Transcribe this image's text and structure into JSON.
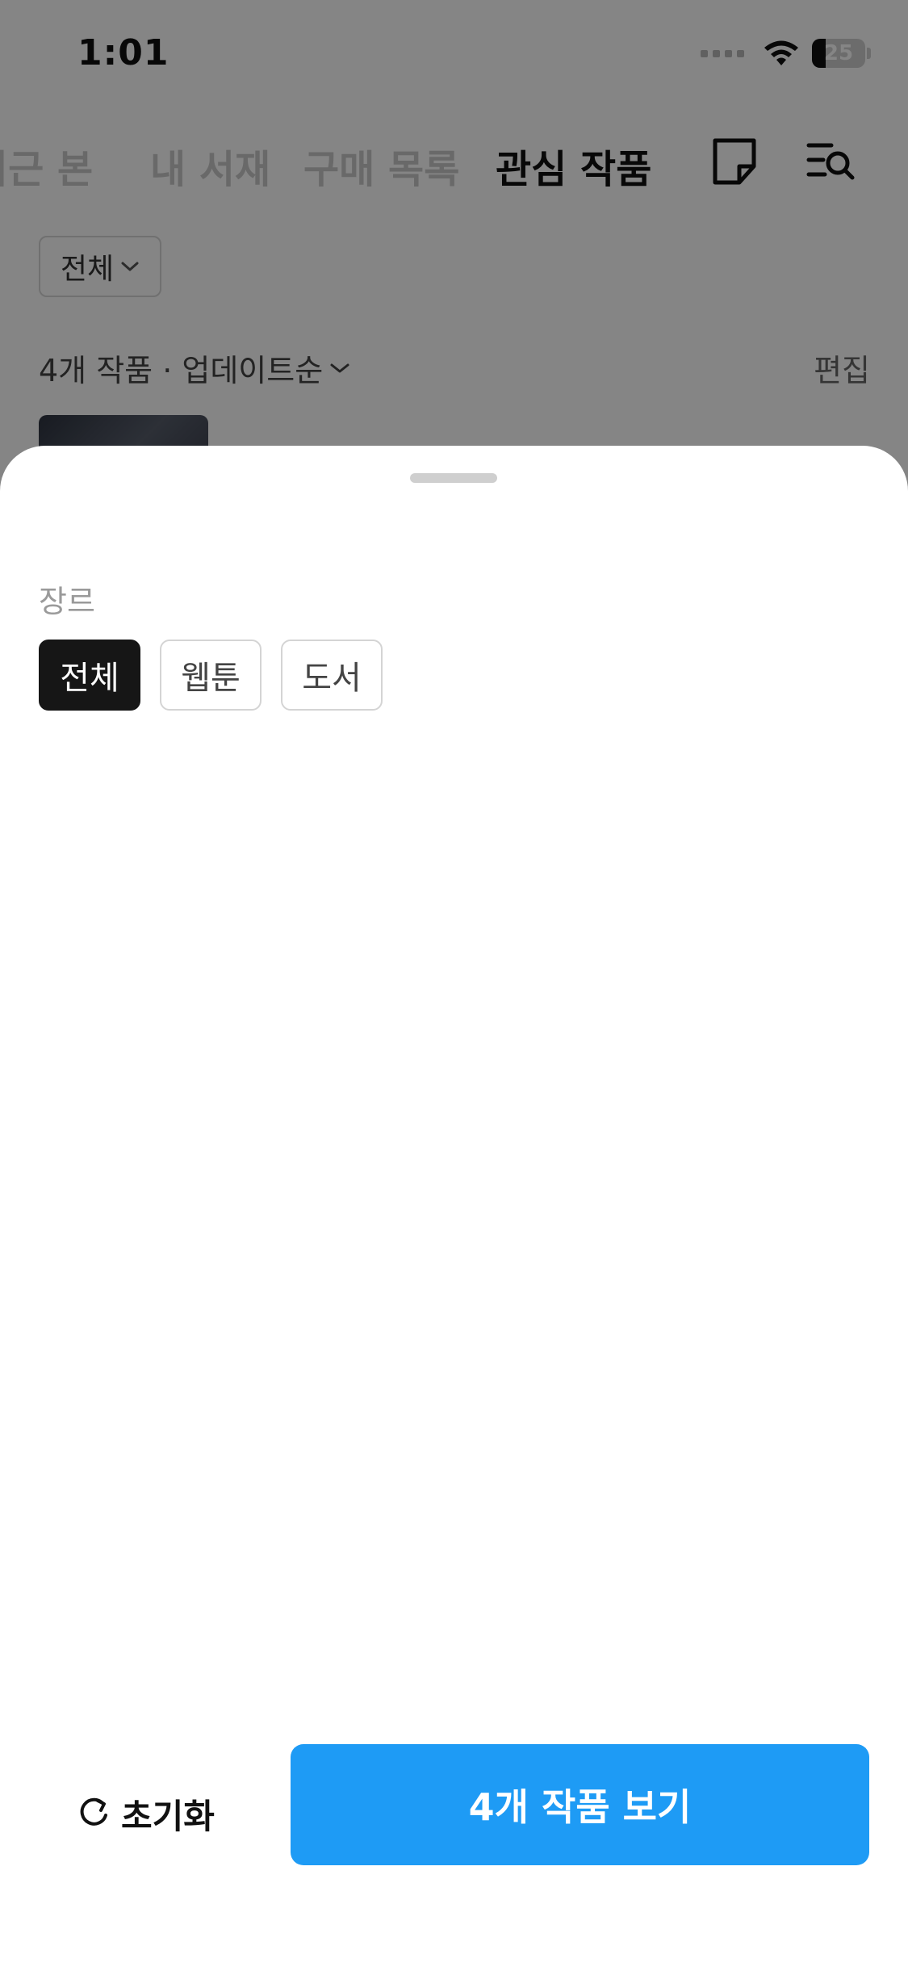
{
  "status_bar": {
    "time": "1:01",
    "battery": "25",
    "battery_level": 0.25
  },
  "top_tabs": [
    {
      "label": "최근 본",
      "active": false
    },
    {
      "label": "내 서재",
      "active": false
    },
    {
      "label": "구매 목록",
      "active": false
    },
    {
      "label": "관심 작품",
      "active": true
    }
  ],
  "icons": {
    "note": "note-icon",
    "search_list": "list-search-icon",
    "chevron": "chevron-down-icon",
    "reset": "refresh-icon",
    "wifi": "wifi-icon",
    "battery": "battery-icon",
    "signal": "signal-icon"
  },
  "filter": {
    "label": "전체"
  },
  "sort_row": {
    "summary": "4개 작품 · 업데이트순",
    "edit": "편집"
  },
  "sheet": {
    "section_title": "장르",
    "chips": [
      {
        "label": "전체",
        "selected": true
      },
      {
        "label": "웹툰",
        "selected": false
      },
      {
        "label": "도서",
        "selected": false
      }
    ],
    "reset_label": "초기화",
    "confirm_label": "4개 작품 보기"
  },
  "colors": {
    "accent": "#1e9bf5",
    "selected_chip": "#161616",
    "scrim": "rgba(0,0,0,0.48)"
  }
}
